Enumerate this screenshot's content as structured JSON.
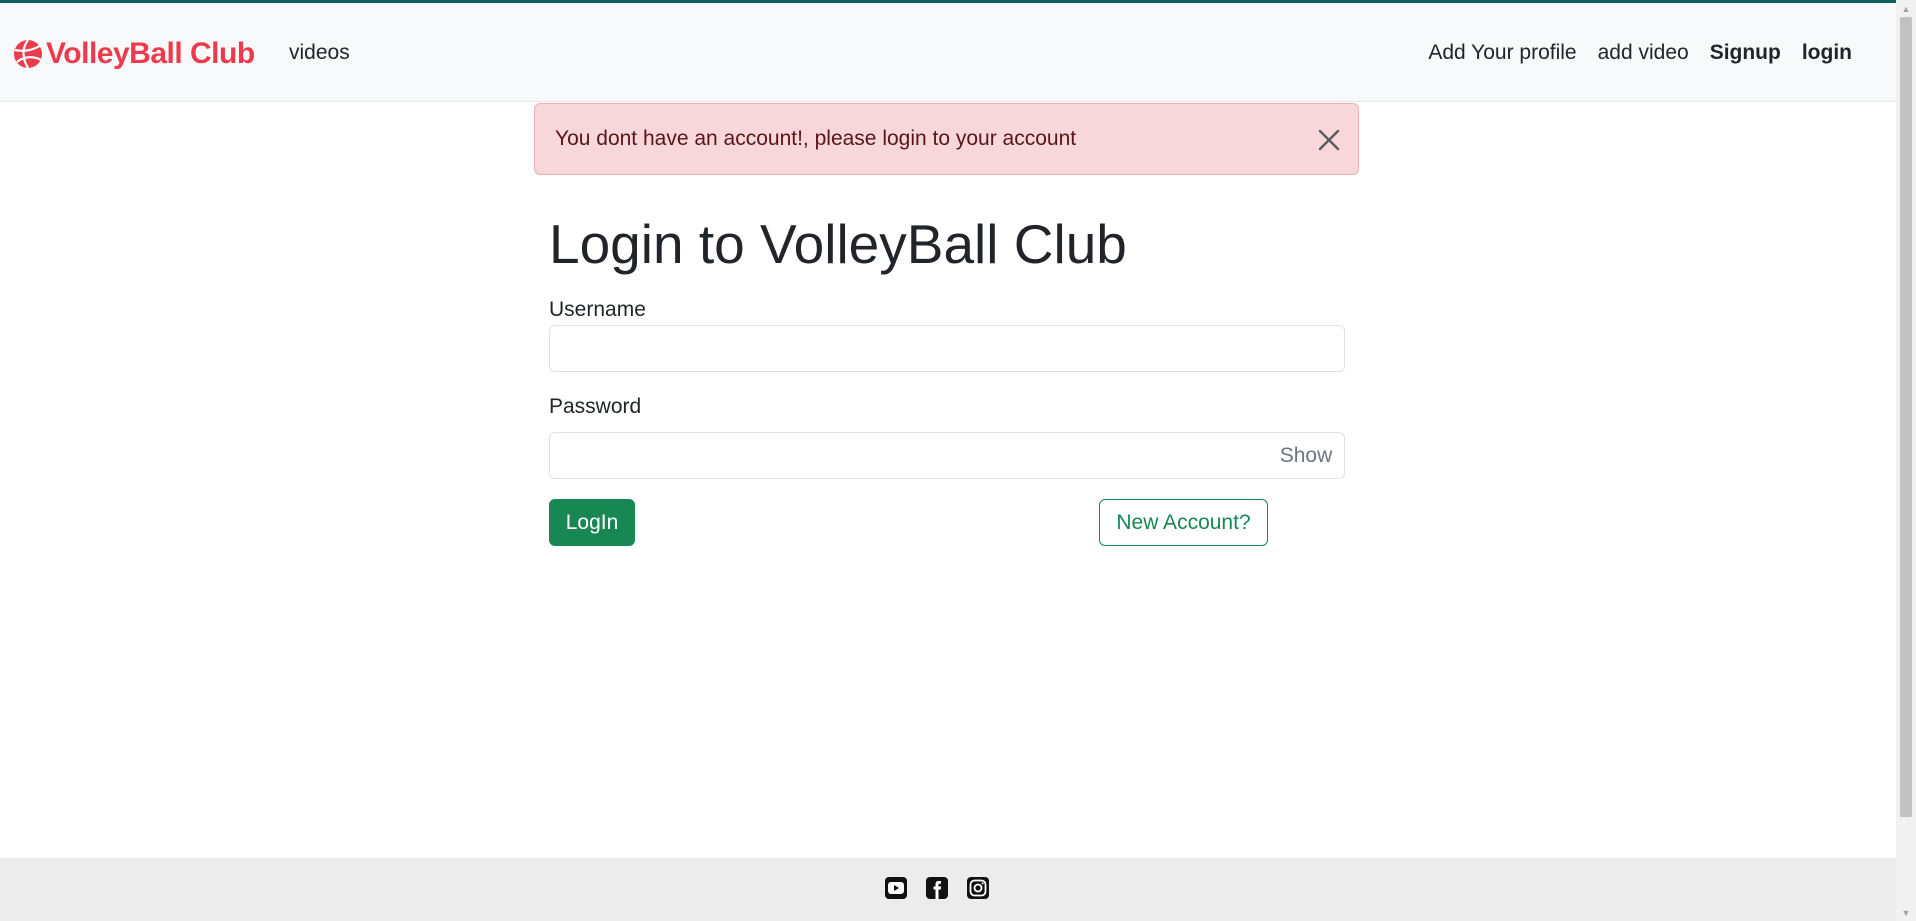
{
  "navbar": {
    "brand": "VolleyBall Club",
    "left_links": [
      "videos"
    ],
    "right_links": [
      "Add Your profile",
      "add video",
      "Signup",
      "login"
    ]
  },
  "alert": {
    "message": "You dont have an account!, please login to your account"
  },
  "form": {
    "title": "Login to VolleyBall Club",
    "username_label": "Username",
    "username_value": "",
    "password_label": "Password",
    "password_value": "",
    "show_label": "Show",
    "login_button": "LogIn",
    "new_account_button": "New Account?"
  },
  "footer": {
    "icons": [
      "youtube-icon",
      "facebook-icon",
      "instagram-icon"
    ]
  },
  "colors": {
    "brand": "#ec3b4d",
    "primary_green": "#198754",
    "alert_bg": "#f8d7da",
    "alert_text": "#58151c"
  }
}
